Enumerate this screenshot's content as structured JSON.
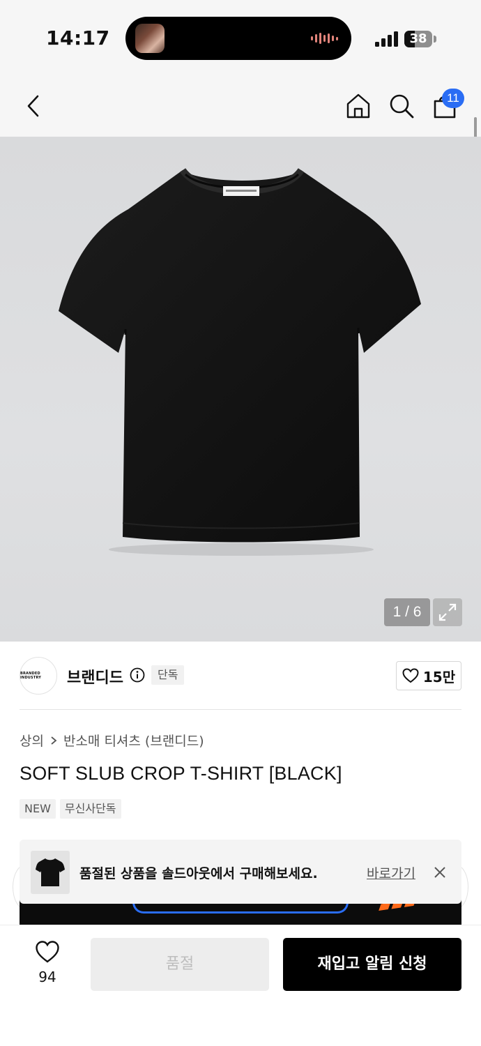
{
  "status_bar": {
    "time": "14:17",
    "battery": "38",
    "battery_level": 0.38
  },
  "nav": {
    "back_icon": "chevron-left-icon",
    "home_icon": "home-icon",
    "search_icon": "search-icon",
    "cart_icon": "bag-icon",
    "cart_count": "11"
  },
  "gallery": {
    "counter": "1 / 6",
    "expand_icon": "expand-icon"
  },
  "brand": {
    "logo_text": "BRANDED INDUSTRY",
    "name": "브랜디드",
    "exclusive_tag": "단독",
    "like_count": "15만"
  },
  "product": {
    "breadcrumb": {
      "level1": "상의",
      "level2": "반소매 티셔츠 (브랜디드)"
    },
    "title": "SOFT SLUB CROP T-SHIRT [BLACK]",
    "tags": [
      "NEW",
      "무신사단독"
    ]
  },
  "toast": {
    "message": "품절된 상품을 솔드아웃에서 구매해보세요.",
    "link": "바로가기"
  },
  "bottom_bar": {
    "wish_count": "94",
    "soldout_label": "품절",
    "restock_label": "재입고 알림 신청"
  },
  "colors": {
    "accent": "#2a6df4",
    "primary_button": "#000000",
    "disabled_button": "#ededed",
    "banner_orange": "#ff6a1a"
  }
}
